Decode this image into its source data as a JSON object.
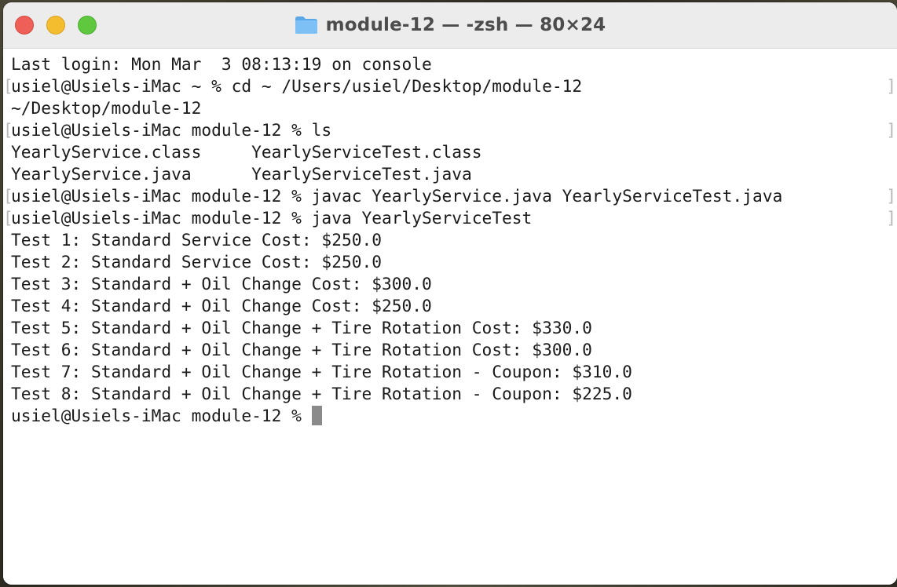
{
  "window": {
    "title": "module-12 — -zsh — 80×24",
    "folder_icon": "folder-icon"
  },
  "terminal": {
    "lines": [
      {
        "text": "Last login: Mon Mar  3 08:13:19 on console",
        "marked": false
      },
      {
        "text": "usiel@Usiels-iMac ~ % cd ~ /Users/usiel/Desktop/module-12",
        "marked": true
      },
      {
        "text": "~/Desktop/module-12",
        "marked": false
      },
      {
        "text": "usiel@Usiels-iMac module-12 % ls",
        "marked": true
      },
      {
        "text": "YearlyService.class     YearlyServiceTest.class",
        "marked": false
      },
      {
        "text": "YearlyService.java      YearlyServiceTest.java",
        "marked": false
      },
      {
        "text": "usiel@Usiels-iMac module-12 % javac YearlyService.java YearlyServiceTest.java",
        "marked": true
      },
      {
        "text": "usiel@Usiels-iMac module-12 % java YearlyServiceTest",
        "marked": true
      },
      {
        "text": "Test 1: Standard Service Cost: $250.0",
        "marked": false
      },
      {
        "text": "Test 2: Standard Service Cost: $250.0",
        "marked": false
      },
      {
        "text": "Test 3: Standard + Oil Change Cost: $300.0",
        "marked": false
      },
      {
        "text": "Test 4: Standard + Oil Change Cost: $250.0",
        "marked": false
      },
      {
        "text": "Test 5: Standard + Oil Change + Tire Rotation Cost: $330.0",
        "marked": false
      },
      {
        "text": "Test 6: Standard + Oil Change + Tire Rotation Cost: $300.0",
        "marked": false
      },
      {
        "text": "Test 7: Standard + Oil Change + Tire Rotation - Coupon: $310.0",
        "marked": false
      },
      {
        "text": "Test 8: Standard + Oil Change + Tire Rotation - Coupon: $225.0",
        "marked": false
      }
    ],
    "prompt": "usiel@Usiels-iMac module-12 % "
  },
  "colors": {
    "close": "#ee5f57",
    "minimize": "#f4bd2f",
    "zoom": "#5fc83f",
    "text": "#1a1a1a",
    "cursor": "#8a8a8a"
  }
}
